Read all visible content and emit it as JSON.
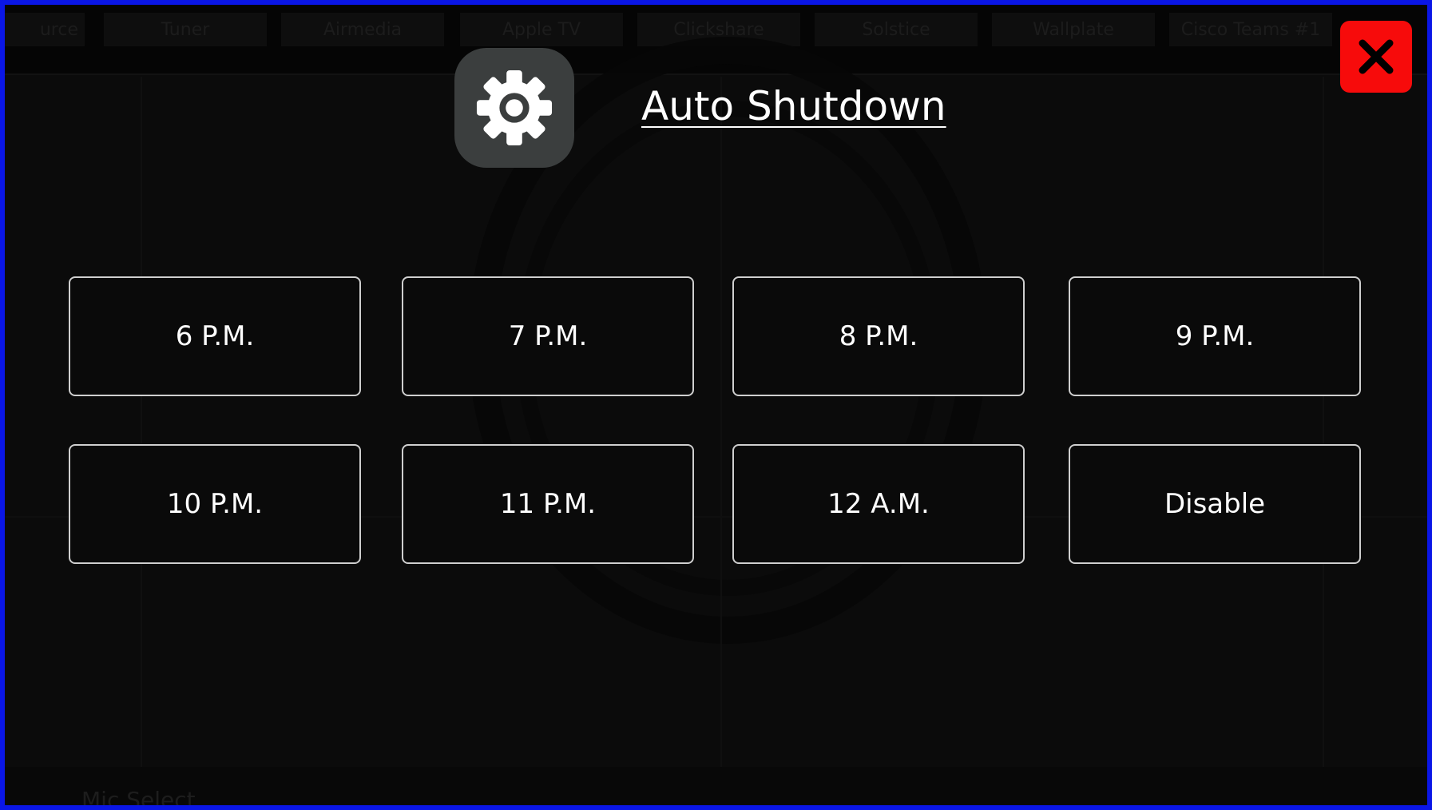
{
  "background": {
    "tabs": [
      "urce",
      "Tuner",
      "Airmedia",
      "Apple TV",
      "Clickshare",
      "Solstice",
      "Wallplate",
      "Cisco Teams #1"
    ],
    "bottom_label": "Mic Select"
  },
  "dialog": {
    "title": "Auto Shutdown",
    "icon": "gear-icon",
    "close_icon": "close-icon",
    "options": [
      {
        "label": "6 P.M."
      },
      {
        "label": "7 P.M."
      },
      {
        "label": "8 P.M."
      },
      {
        "label": "9 P.M."
      },
      {
        "label": "10 P.M."
      },
      {
        "label": "11 P.M."
      },
      {
        "label": "12 A.M."
      },
      {
        "label": "Disable"
      }
    ]
  },
  "colors": {
    "frame_border": "#0a16e6",
    "close_button": "#f70b0b",
    "icon_box": "#3b3e3e"
  }
}
